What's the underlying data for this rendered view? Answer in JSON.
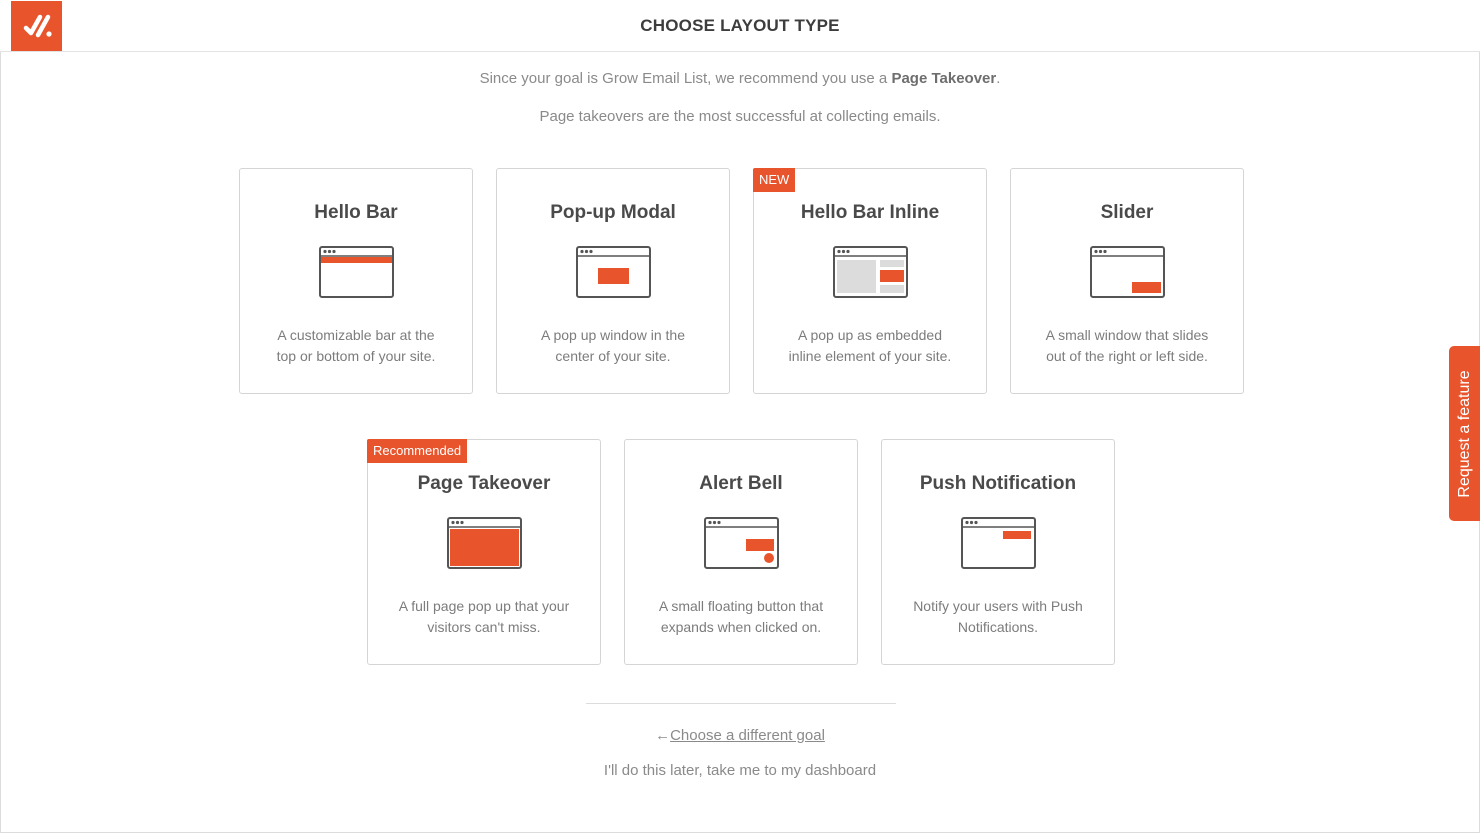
{
  "header": {
    "title": "CHOOSE LAYOUT TYPE",
    "logo_icon": "hellobar-logo-icon"
  },
  "intro": {
    "line1_prefix": "Since your goal is Grow Email List, we recommend you use a ",
    "line1_bold": "Page Takeover",
    "line1_suffix": ".",
    "line2": "Page takeovers are the most successful at collecting emails."
  },
  "cards": [
    {
      "title": "Hello Bar",
      "desc_line1": "A customizable bar at the",
      "desc_line2": "top or bottom of your site.",
      "icon": "hello-bar-layout-icon",
      "badge": ""
    },
    {
      "title": "Pop-up Modal",
      "desc_line1": "A pop up window in the",
      "desc_line2": "center of your site.",
      "icon": "modal-layout-icon",
      "badge": ""
    },
    {
      "title": "Hello Bar Inline",
      "desc_line1": "A pop up as embedded",
      "desc_line2": "inline element of your site.",
      "icon": "inline-layout-icon",
      "badge": "NEW"
    },
    {
      "title": "Slider",
      "desc_line1": "A small window that slides",
      "desc_line2": "out of the right or left side.",
      "icon": "slider-layout-icon",
      "badge": ""
    },
    {
      "title": "Page Takeover",
      "desc_line1": "A full page pop up that your",
      "desc_line2": "visitors can't miss.",
      "icon": "takeover-layout-icon",
      "badge": "Recommended"
    },
    {
      "title": "Alert Bell",
      "desc_line1": "A small floating button that",
      "desc_line2": "expands when clicked on.",
      "icon": "alert-bell-layout-icon",
      "badge": ""
    },
    {
      "title": "Push Notification",
      "desc_line1": "Notify your users with Push",
      "desc_line2": "Notifications.",
      "icon": "push-notification-layout-icon",
      "badge": ""
    }
  ],
  "footer": {
    "back_arrow": "←",
    "back_label": "Choose a different goal",
    "later_label": "I'll do this later, take me to my dashboard"
  },
  "side_tab": {
    "label": "Request a feature"
  },
  "colors": {
    "accent": "#e8552d",
    "border": "#d5d5d5",
    "text": "#4a4a4a",
    "muted": "#8a8a8a"
  }
}
